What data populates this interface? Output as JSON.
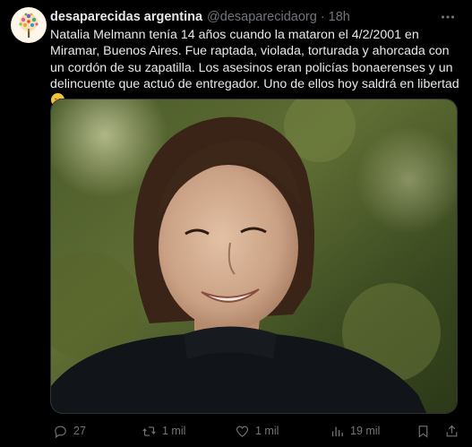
{
  "author": {
    "display_name": "desaparecidas argentina",
    "handle": "@desaparecidaorg",
    "separator": "·",
    "time": "18h"
  },
  "tweet": {
    "text": "Natalia Melmann tenía 14 años cuando la mataron el 4/2/2001 en Miramar, Buenos Aires. Fue raptada, violada, torturada y ahorcada con un cordón de su zapatilla. Los asesinos eran policías bonaerenses y un delincuente que actuó de entregador. Uno de ellos hoy saldrá en libertad",
    "emoji": "disappointed-face"
  },
  "actions": {
    "replies": "27",
    "reposts": "1 mil",
    "likes": "1 mil",
    "views": "19 mil"
  },
  "icons": {
    "more": "more-dots-icon",
    "reply": "reply-icon",
    "repost": "repost-icon",
    "like": "heart-icon",
    "views": "views-chart-icon",
    "bookmark": "bookmark-icon",
    "share": "share-icon"
  },
  "colors": {
    "background": "#000000",
    "text": "#e7e9ea",
    "muted": "#71767b",
    "emoji": "#f5c33b"
  }
}
